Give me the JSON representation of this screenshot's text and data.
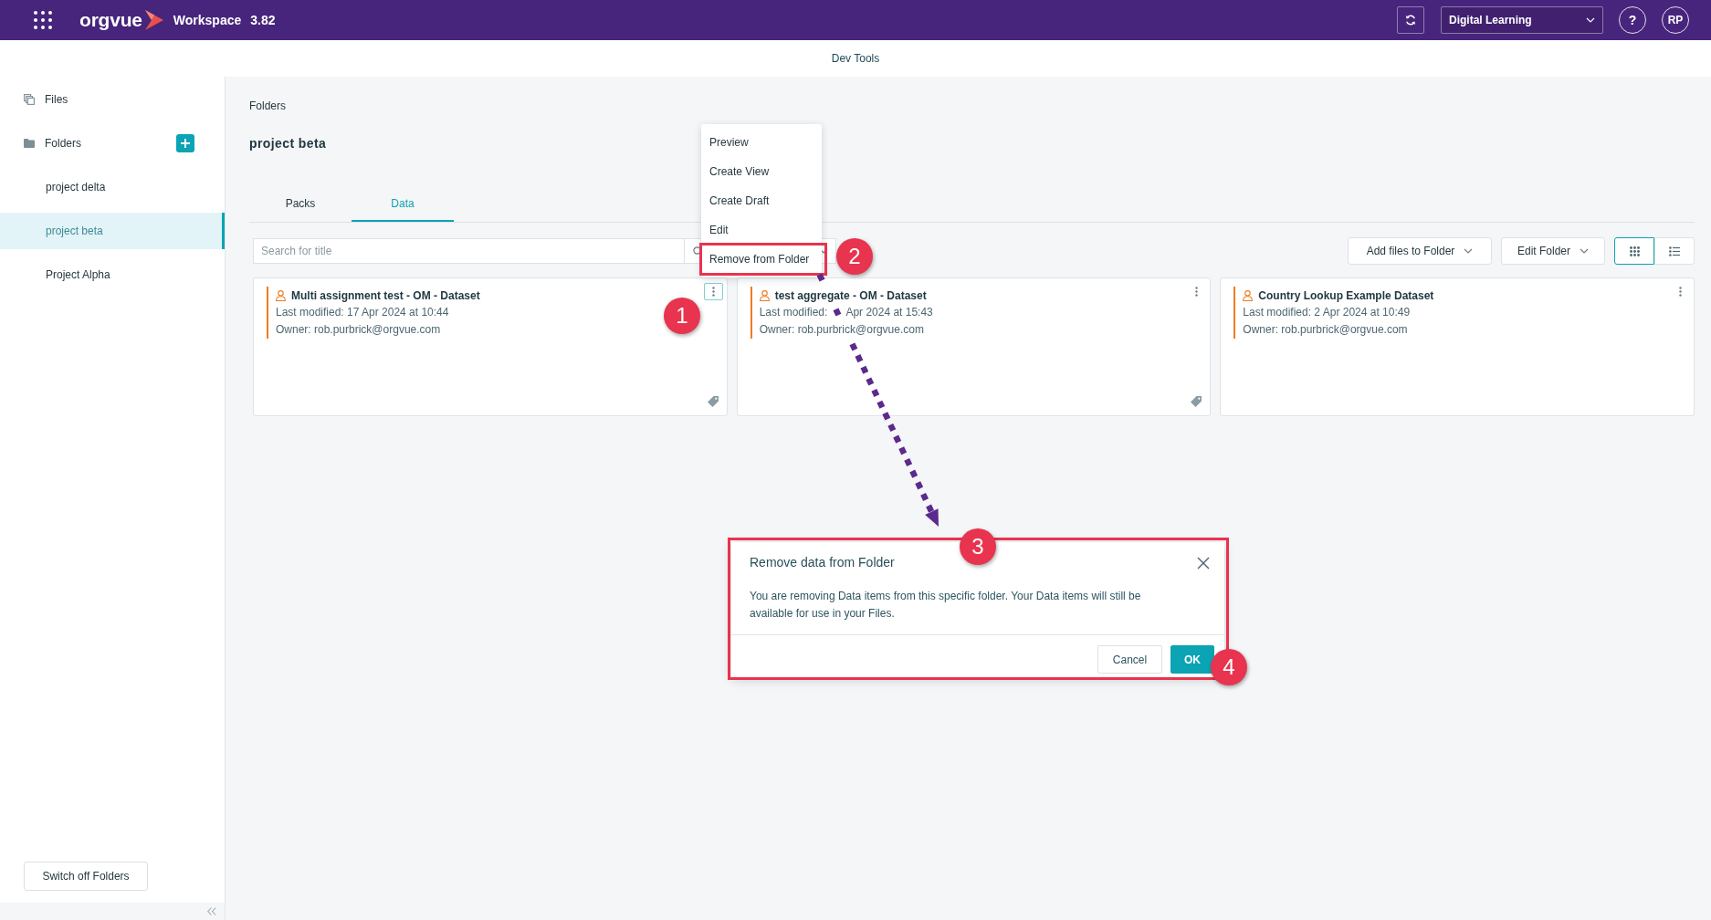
{
  "header": {
    "logo": "orgvue",
    "product": "Workspace",
    "version": "3.82",
    "workspace_selector": "Digital Learning",
    "help": "?",
    "user_initials": "RP"
  },
  "sub_header": {
    "title": "Dev Tools"
  },
  "sidebar": {
    "items": [
      {
        "label": "Files",
        "kind": "files"
      },
      {
        "label": "Folders",
        "kind": "folders"
      }
    ],
    "folders": [
      {
        "label": "project delta",
        "selected": false
      },
      {
        "label": "project beta",
        "selected": true
      },
      {
        "label": "Project Alpha",
        "selected": false
      }
    ],
    "footer_button": "Switch off Folders"
  },
  "breadcrumb": "Folders",
  "title": "project beta",
  "tabs": [
    {
      "label": "Packs",
      "selected": false
    },
    {
      "label": "Data",
      "selected": true
    }
  ],
  "search": {
    "placeholder": "Search for title"
  },
  "toolbar": {
    "add_files": "Add files to Folder",
    "edit_folder": "Edit Folder",
    "views": [
      {
        "kind": "grid",
        "selected": true
      },
      {
        "kind": "list",
        "selected": false
      }
    ]
  },
  "cards": [
    {
      "title": "Multi assignment test - OM - Dataset",
      "modified": [
        "Last modified: 17 Apr 2024 at 10:44"
      ],
      "owner": "Owner: rob.purbrick@orgvue.com",
      "menu_active": true,
      "tagged": true
    },
    {
      "title": "test aggregate - OM - Dataset",
      "modified": [
        "Last modified:",
        "Apr 2024 at 15:43"
      ],
      "owner": "Owner: rob.purbrick@orgvue.com",
      "menu_active": false,
      "tagged": true
    },
    {
      "title": "Country Lookup Example Dataset",
      "modified": [
        "Last modified: 2 Apr 2024 at 10:49"
      ],
      "owner": "Owner: rob.purbrick@orgvue.com",
      "menu_active": false,
      "tagged": false
    }
  ],
  "context_menu": {
    "items": [
      {
        "label": "Preview",
        "annotated": false
      },
      {
        "label": "Create View",
        "annotated": false
      },
      {
        "label": "Create Draft",
        "annotated": false
      },
      {
        "label": "Edit",
        "annotated": false
      },
      {
        "label": "Remove from Folder",
        "annotated": true
      }
    ]
  },
  "dialog": {
    "title": "Remove data from Folder",
    "message": "You are removing Data items from this specific folder. Your Data items will still be available for use in your Files.",
    "annotated": true,
    "buttons": [
      {
        "label": "Cancel",
        "kind": "secondary"
      },
      {
        "label": "OK",
        "kind": "primary"
      }
    ]
  },
  "annotations": {
    "steps": [
      {
        "number": "1"
      },
      {
        "number": "2"
      },
      {
        "number": "3"
      },
      {
        "number": "4"
      }
    ]
  }
}
